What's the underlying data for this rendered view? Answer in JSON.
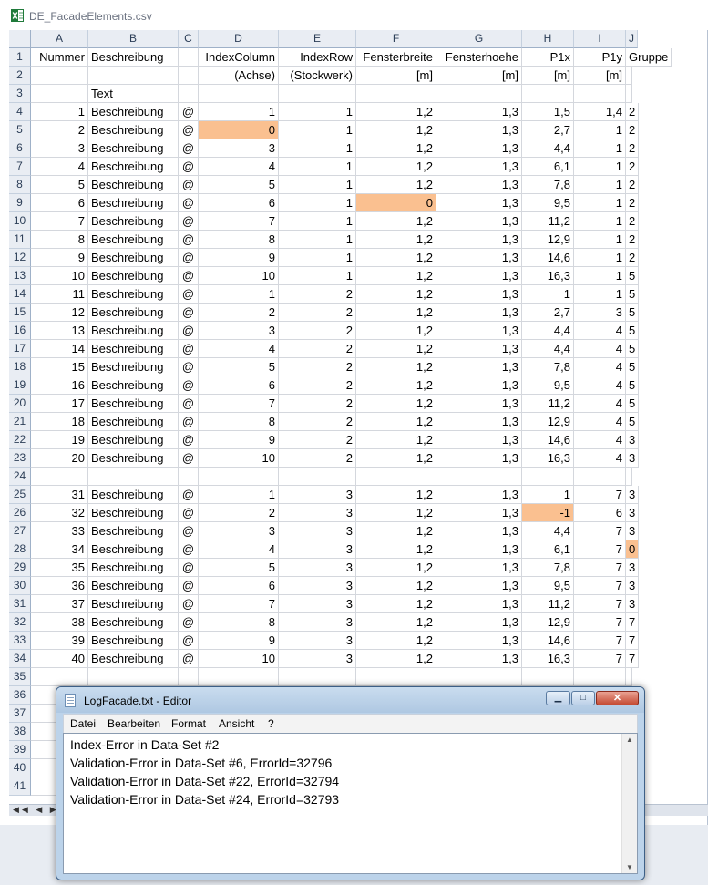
{
  "window": {
    "title": "DE_FacadeElements.csv",
    "file_icon": "excel-icon"
  },
  "columns": [
    "A",
    "B",
    "C",
    "D",
    "E",
    "F",
    "G",
    "H",
    "I",
    "J"
  ],
  "rows": [
    {
      "n": "1",
      "cells": [
        "Nummer",
        "Beschreibung",
        "",
        "IndexColumn",
        "IndexRow",
        "Fensterbreite",
        "Fensterhoehe",
        "P1x",
        "P1y",
        "Gruppe"
      ]
    },
    {
      "n": "2",
      "cells": [
        "",
        "",
        "",
        "(Achse)",
        "(Stockwerk)",
        "[m]",
        "[m]",
        "[m]",
        "[m]",
        ""
      ]
    },
    {
      "n": "3",
      "cells": [
        "",
        "Text",
        "",
        "",
        "",
        "",
        "",
        "",
        "",
        ""
      ]
    },
    {
      "n": "4",
      "cells": [
        "1",
        "Beschreibung",
        "@",
        "1",
        "1",
        "1,2",
        "1,3",
        "1,5",
        "1,4",
        "2"
      ]
    },
    {
      "n": "5",
      "cells": [
        "2",
        "Beschreibung",
        "@",
        "0",
        "1",
        "1,2",
        "1,3",
        "2,7",
        "1",
        "2"
      ]
    },
    {
      "n": "6",
      "cells": [
        "3",
        "Beschreibung",
        "@",
        "3",
        "1",
        "1,2",
        "1,3",
        "4,4",
        "1",
        "2"
      ]
    },
    {
      "n": "7",
      "cells": [
        "4",
        "Beschreibung",
        "@",
        "4",
        "1",
        "1,2",
        "1,3",
        "6,1",
        "1",
        "2"
      ]
    },
    {
      "n": "8",
      "cells": [
        "5",
        "Beschreibung",
        "@",
        "5",
        "1",
        "1,2",
        "1,3",
        "7,8",
        "1",
        "2"
      ]
    },
    {
      "n": "9",
      "cells": [
        "6",
        "Beschreibung",
        "@",
        "6",
        "1",
        "0",
        "1,3",
        "9,5",
        "1",
        "2"
      ]
    },
    {
      "n": "10",
      "cells": [
        "7",
        "Beschreibung",
        "@",
        "7",
        "1",
        "1,2",
        "1,3",
        "11,2",
        "1",
        "2"
      ]
    },
    {
      "n": "11",
      "cells": [
        "8",
        "Beschreibung",
        "@",
        "8",
        "1",
        "1,2",
        "1,3",
        "12,9",
        "1",
        "2"
      ]
    },
    {
      "n": "12",
      "cells": [
        "9",
        "Beschreibung",
        "@",
        "9",
        "1",
        "1,2",
        "1,3",
        "14,6",
        "1",
        "2"
      ]
    },
    {
      "n": "13",
      "cells": [
        "10",
        "Beschreibung",
        "@",
        "10",
        "1",
        "1,2",
        "1,3",
        "16,3",
        "1",
        "5"
      ]
    },
    {
      "n": "14",
      "cells": [
        "11",
        "Beschreibung",
        "@",
        "1",
        "2",
        "1,2",
        "1,3",
        "1",
        "1",
        "5"
      ]
    },
    {
      "n": "15",
      "cells": [
        "12",
        "Beschreibung",
        "@",
        "2",
        "2",
        "1,2",
        "1,3",
        "2,7",
        "3",
        "5"
      ]
    },
    {
      "n": "16",
      "cells": [
        "13",
        "Beschreibung",
        "@",
        "3",
        "2",
        "1,2",
        "1,3",
        "4,4",
        "4",
        "5"
      ]
    },
    {
      "n": "17",
      "cells": [
        "14",
        "Beschreibung",
        "@",
        "4",
        "2",
        "1,2",
        "1,3",
        "4,4",
        "4",
        "5"
      ]
    },
    {
      "n": "18",
      "cells": [
        "15",
        "Beschreibung",
        "@",
        "5",
        "2",
        "1,2",
        "1,3",
        "7,8",
        "4",
        "5"
      ]
    },
    {
      "n": "19",
      "cells": [
        "16",
        "Beschreibung",
        "@",
        "6",
        "2",
        "1,2",
        "1,3",
        "9,5",
        "4",
        "5"
      ]
    },
    {
      "n": "20",
      "cells": [
        "17",
        "Beschreibung",
        "@",
        "7",
        "2",
        "1,2",
        "1,3",
        "11,2",
        "4",
        "5"
      ]
    },
    {
      "n": "21",
      "cells": [
        "18",
        "Beschreibung",
        "@",
        "8",
        "2",
        "1,2",
        "1,3",
        "12,9",
        "4",
        "5"
      ]
    },
    {
      "n": "22",
      "cells": [
        "19",
        "Beschreibung",
        "@",
        "9",
        "2",
        "1,2",
        "1,3",
        "14,6",
        "4",
        "3"
      ]
    },
    {
      "n": "23",
      "cells": [
        "20",
        "Beschreibung",
        "@",
        "10",
        "2",
        "1,2",
        "1,3",
        "16,3",
        "4",
        "3"
      ]
    },
    {
      "n": "24",
      "cells": [
        "",
        "",
        "",
        "",
        "",
        "",
        "",
        "",
        "",
        ""
      ]
    },
    {
      "n": "25",
      "cells": [
        "31",
        "Beschreibung",
        "@",
        "1",
        "3",
        "1,2",
        "1,3",
        "1",
        "7",
        "3"
      ]
    },
    {
      "n": "26",
      "cells": [
        "32",
        "Beschreibung",
        "@",
        "2",
        "3",
        "1,2",
        "1,3",
        "-1",
        "6",
        "3"
      ]
    },
    {
      "n": "27",
      "cells": [
        "33",
        "Beschreibung",
        "@",
        "3",
        "3",
        "1,2",
        "1,3",
        "4,4",
        "7",
        "3"
      ]
    },
    {
      "n": "28",
      "cells": [
        "34",
        "Beschreibung",
        "@",
        "4",
        "3",
        "1,2",
        "1,3",
        "6,1",
        "7",
        "0"
      ]
    },
    {
      "n": "29",
      "cells": [
        "35",
        "Beschreibung",
        "@",
        "5",
        "3",
        "1,2",
        "1,3",
        "7,8",
        "7",
        "3"
      ]
    },
    {
      "n": "30",
      "cells": [
        "36",
        "Beschreibung",
        "@",
        "6",
        "3",
        "1,2",
        "1,3",
        "9,5",
        "7",
        "3"
      ]
    },
    {
      "n": "31",
      "cells": [
        "37",
        "Beschreibung",
        "@",
        "7",
        "3",
        "1,2",
        "1,3",
        "11,2",
        "7",
        "3"
      ]
    },
    {
      "n": "32",
      "cells": [
        "38",
        "Beschreibung",
        "@",
        "8",
        "3",
        "1,2",
        "1,3",
        "12,9",
        "7",
        "7"
      ]
    },
    {
      "n": "33",
      "cells": [
        "39",
        "Beschreibung",
        "@",
        "9",
        "3",
        "1,2",
        "1,3",
        "14,6",
        "7",
        "7"
      ]
    },
    {
      "n": "34",
      "cells": [
        "40",
        "Beschreibung",
        "@",
        "10",
        "3",
        "1,2",
        "1,3",
        "16,3",
        "7",
        "7"
      ]
    },
    {
      "n": "35",
      "cells": [
        "",
        "",
        "",
        "",
        "",
        "",
        "",
        "",
        "",
        ""
      ]
    },
    {
      "n": "36",
      "cells": [
        "",
        "",
        "",
        "",
        "",
        "",
        "",
        "",
        "",
        ""
      ]
    },
    {
      "n": "37",
      "cells": [
        "",
        "",
        "",
        "",
        "",
        "",
        "",
        "",
        "",
        ""
      ]
    },
    {
      "n": "38",
      "cells": [
        "",
        "",
        "",
        "",
        "",
        "",
        "",
        "",
        "",
        ""
      ]
    },
    {
      "n": "39",
      "cells": [
        "",
        "",
        "",
        "",
        "",
        "",
        "",
        "",
        "",
        ""
      ]
    },
    {
      "n": "40",
      "cells": [
        "",
        "",
        "",
        "",
        "",
        "",
        "",
        "",
        "",
        ""
      ]
    },
    {
      "n": "41",
      "cells": [
        "",
        "",
        "",
        "",
        "",
        "",
        "",
        "",
        "",
        ""
      ]
    }
  ],
  "highlighted_cells": [
    "D5",
    "F9",
    "H26",
    "J28"
  ],
  "highlight_color": "#fac090",
  "sheet_nav": "◀◀ ◀ ▶ ▶▶",
  "notepad": {
    "title": "LogFacade.txt - Editor",
    "icon": "notepad-icon",
    "minimize_label": "▁",
    "maximize_label": "□",
    "close_label": "✕",
    "menu": [
      "Datei",
      "Bearbeiten",
      "Format",
      "Ansicht",
      "?"
    ],
    "lines": [
      "Index-Error in Data-Set #2",
      "Validation-Error in Data-Set #6, ErrorId=32796",
      "Validation-Error in Data-Set #22, ErrorId=32794",
      "Validation-Error in Data-Set #24, ErrorId=32793"
    ]
  }
}
